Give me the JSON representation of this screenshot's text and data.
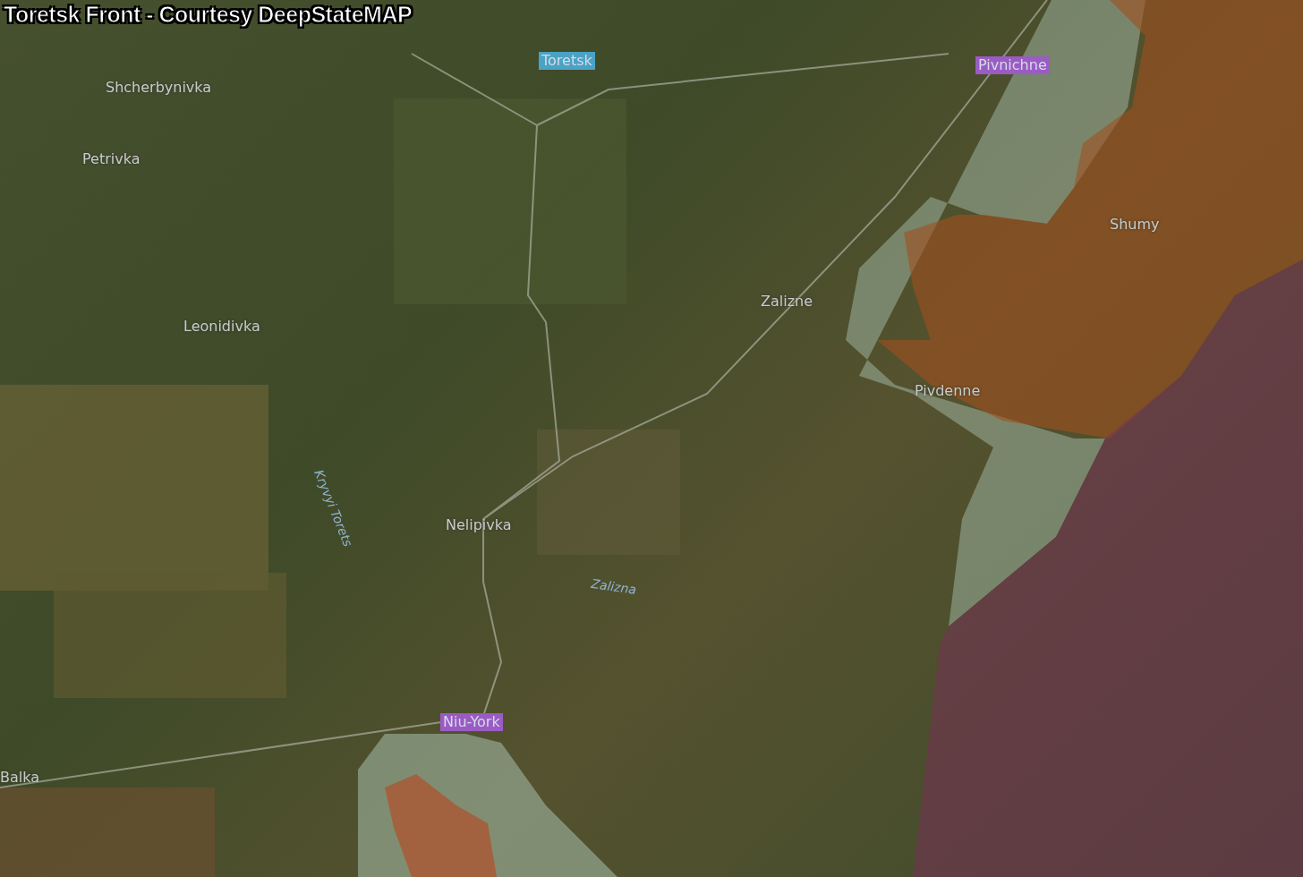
{
  "title": "Toretsk Front - Courtesy DeepStateMAP",
  "labels": [
    {
      "text": "Toretsk",
      "kind": "boxed",
      "color": "#4aa3c4"
    },
    {
      "text": "Pivnichne",
      "kind": "boxed",
      "color": "#9a5cc4"
    },
    {
      "text": "Shcherbynivka",
      "kind": "place"
    },
    {
      "text": "Petrivka",
      "kind": "place"
    },
    {
      "text": "Shumy",
      "kind": "place"
    },
    {
      "text": "Zalizne",
      "kind": "place"
    },
    {
      "text": "Leonidivka",
      "kind": "place"
    },
    {
      "text": "Pivdenne",
      "kind": "place"
    },
    {
      "text": "Kryvyi Torets",
      "kind": "river"
    },
    {
      "text": "Nelipivka",
      "kind": "place"
    },
    {
      "text": "Zalizna",
      "kind": "river"
    },
    {
      "text": "Niu-York",
      "kind": "boxed",
      "color": "#9a5cc4"
    },
    {
      "text": "Balka",
      "kind": "place"
    }
  ]
}
